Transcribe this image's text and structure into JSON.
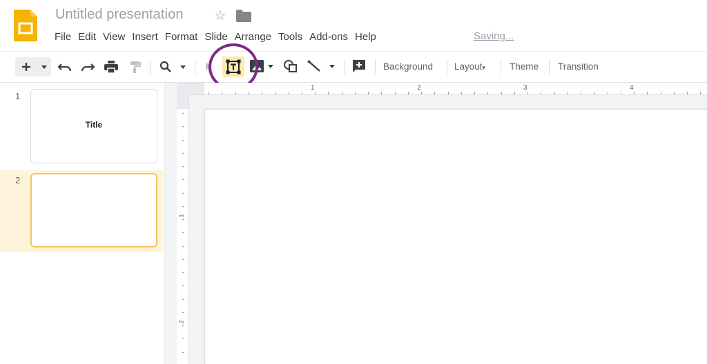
{
  "app": {
    "doc_title": "Untitled presentation",
    "status": "Saving..."
  },
  "menu": [
    "File",
    "Edit",
    "View",
    "Insert",
    "Format",
    "Slide",
    "Arrange",
    "Tools",
    "Add-ons",
    "Help"
  ],
  "toolbar": {
    "background_label": "Background",
    "layout_label": "Layout",
    "theme_label": "Theme",
    "transition_label": "Transition",
    "active_tool": "text-box-icon"
  },
  "ruler": {
    "h_numbers": [
      "1",
      "2",
      "3",
      "4"
    ],
    "v_numbers": [
      "1",
      "2"
    ]
  },
  "slides": [
    {
      "number": "1",
      "title": "Title",
      "selected": false
    },
    {
      "number": "2",
      "title": "",
      "selected": true
    }
  ],
  "colors": {
    "logo": "#f4b400",
    "active_tool_bg": "#fdeab1",
    "highlight_circle": "#7b2a85",
    "selected_slide_border": "#f8c15c"
  }
}
